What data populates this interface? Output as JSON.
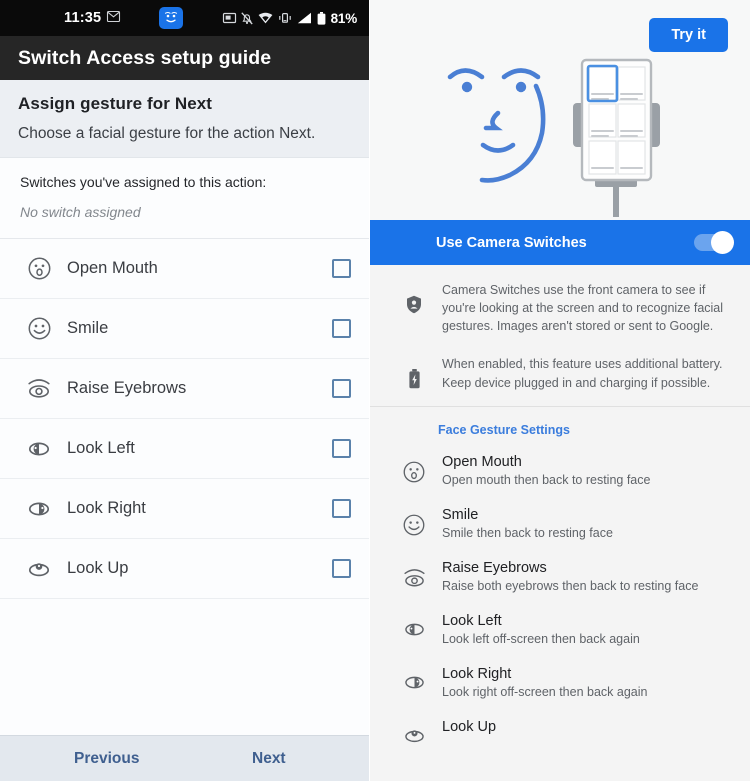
{
  "left": {
    "status_bar": {
      "time": "11:35",
      "battery_text": "81%",
      "icons": [
        "envelope-icon",
        "face-switch-icon",
        "screenshot-icon",
        "notifications-off-icon",
        "wifi-icon",
        "vibrate-icon",
        "signal-icon",
        "battery-icon"
      ]
    },
    "app_bar": {
      "title": "Switch Access setup guide"
    },
    "section": {
      "title": "Assign gesture for Next",
      "subtitle": "Choose a facial gesture for the action Next."
    },
    "assigned": {
      "label": "Switches you've assigned to this action:",
      "value": "No switch assigned"
    },
    "gestures": [
      {
        "label": "Open Mouth",
        "icon": "open-mouth-icon",
        "checked": false
      },
      {
        "label": "Smile",
        "icon": "smile-icon",
        "checked": false
      },
      {
        "label": "Raise Eyebrows",
        "icon": "raise-eyebrows-icon",
        "checked": false
      },
      {
        "label": "Look Left",
        "icon": "look-left-icon",
        "checked": false
      },
      {
        "label": "Look Right",
        "icon": "look-right-icon",
        "checked": false
      },
      {
        "label": "Look Up",
        "icon": "look-up-icon",
        "checked": false
      }
    ],
    "bottom_bar": {
      "previous": "Previous",
      "next": "Next"
    }
  },
  "right": {
    "hero": {
      "try_it_label": "Try it"
    },
    "banner": {
      "label": "Use Camera Switches",
      "toggle_on": true
    },
    "info_rows": [
      {
        "icon": "privacy-shield-icon",
        "text": "Camera Switches use the front camera to see if you're looking at the screen and to recognize facial gestures. Images aren't stored or sent to Google."
      },
      {
        "icon": "battery-charging-icon",
        "text": "When enabled, this feature uses additional battery. Keep device plugged in and charging if possible."
      }
    ],
    "face_gesture_settings_header": "Face Gesture Settings",
    "gestures": [
      {
        "title": "Open Mouth",
        "subtitle": "Open mouth then back to resting face",
        "icon": "open-mouth-icon"
      },
      {
        "title": "Smile",
        "subtitle": "Smile then back to resting face",
        "icon": "smile-icon"
      },
      {
        "title": "Raise Eyebrows",
        "subtitle": "Raise both eyebrows then back to resting face",
        "icon": "raise-eyebrows-icon"
      },
      {
        "title": "Look Left",
        "subtitle": "Look left off-screen then back again",
        "icon": "look-left-icon"
      },
      {
        "title": "Look Right",
        "subtitle": "Look right off-screen then back again",
        "icon": "look-right-icon"
      },
      {
        "title": "Look Up",
        "subtitle": "",
        "icon": "look-up-icon"
      }
    ]
  },
  "colors": {
    "accent_blue": "#1a73e8",
    "banner_blue": "#1a73e8",
    "link_blue": "#3b7ddd",
    "app_bar": "#262626",
    "status_bar": "#0a0a0a",
    "checkbox_border": "#5b82ab",
    "illustration_blue": "#4a7fd4"
  }
}
